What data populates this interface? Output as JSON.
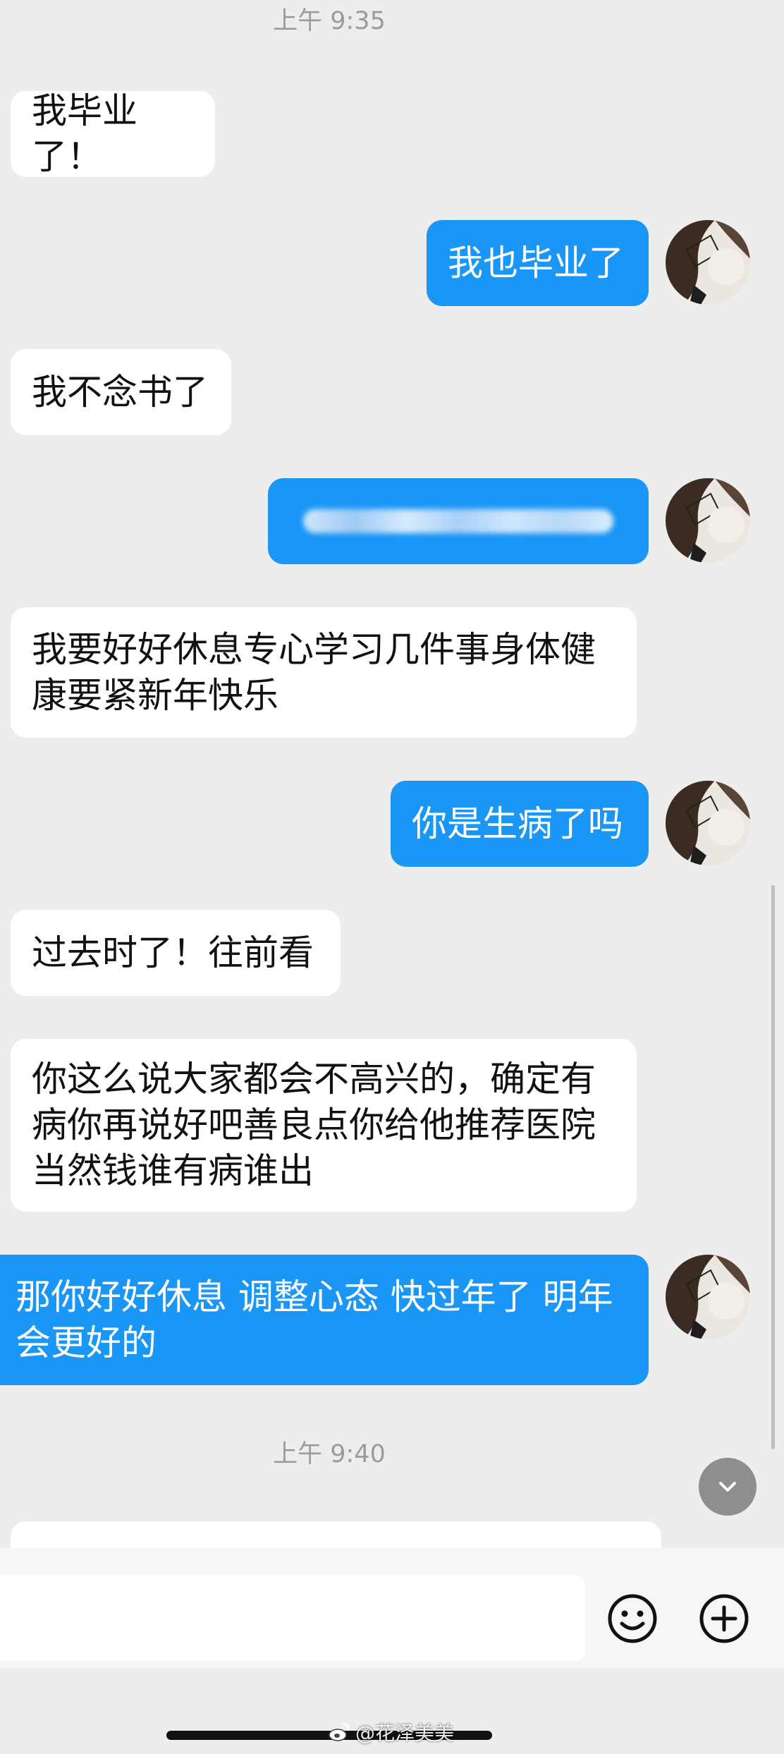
{
  "chat": {
    "timestamp_1": "上午 9:35",
    "timestamp_2": "上午 9:40",
    "messages": [
      {
        "side": "incoming",
        "text": "我毕业了！"
      },
      {
        "side": "outgoing",
        "text": "我也毕业了"
      },
      {
        "side": "incoming",
        "text": "我不念书了"
      },
      {
        "side": "outgoing",
        "text": "",
        "obscured": true
      },
      {
        "side": "incoming",
        "lines": [
          "我要好好休息专心学习几件事身体健",
          "康要紧新年快乐"
        ]
      },
      {
        "side": "outgoing",
        "text": "你是生病了吗"
      },
      {
        "side": "incoming",
        "text": "过去时了！往前看"
      },
      {
        "side": "incoming",
        "lines": [
          "你这么说大家都会不高兴的，确定有",
          "病你再说好吧善良点你给他推荐医院",
          "当然钱谁有病谁出"
        ]
      },
      {
        "side": "outgoing",
        "lines": [
          "那你好好休息 调整心态 快过年了 明年",
          "会更好的"
        ]
      },
      {
        "side": "incoming",
        "text": "",
        "partially_visible": true
      }
    ]
  },
  "input_bar": {
    "emoji_icon": "smiley-face-icon",
    "add_icon": "plus-circle-icon"
  },
  "scroll_down_icon": "chevron-down-icon",
  "watermark": {
    "logo_icon": "weibo-logo-icon",
    "text": "@花泽美美"
  },
  "colors": {
    "background": "#ededed",
    "incoming_bubble": "#ffffff",
    "outgoing_bubble": "#1a96f7",
    "outgoing_text": "#ffffff",
    "timestamp_text": "#9b9b9b"
  }
}
